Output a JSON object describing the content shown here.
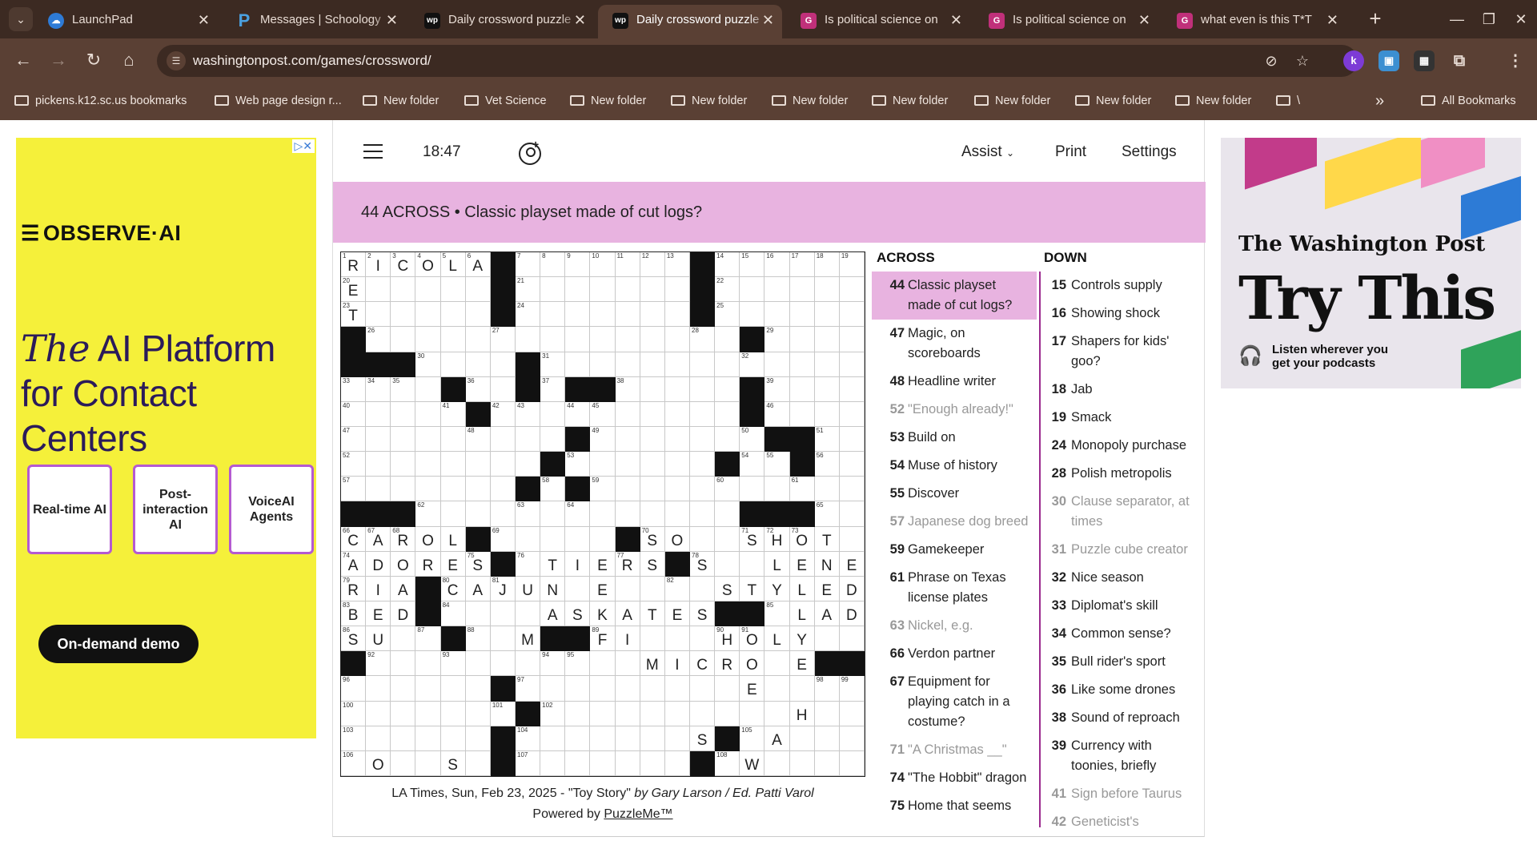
{
  "browser": {
    "tabs": [
      {
        "label": "LaunchPad",
        "icon": "cloud-icon",
        "active": false
      },
      {
        "label": "Messages | Schoology",
        "icon": "schoology-icon",
        "active": false
      },
      {
        "label": "Daily crossword puzzle",
        "icon": "wp-icon",
        "active": false
      },
      {
        "label": "Daily crossword puzzle",
        "icon": "wp-icon",
        "active": true
      },
      {
        "label": "Is political science on",
        "icon": "gl-icon",
        "active": false
      },
      {
        "label": "Is political science on",
        "icon": "gl-icon",
        "active": false
      },
      {
        "label": "what even is this T*T",
        "icon": "gl-icon",
        "active": false
      }
    ],
    "url": "washingtonpost.com/games/crossword/",
    "bookmarks": [
      "pickens.k12.sc.us bookmarks",
      "Web page design r...",
      "New folder",
      "Vet Science",
      "New folder",
      "New folder",
      "New folder",
      "New folder",
      "New folder",
      "New folder",
      "New folder",
      "\\"
    ],
    "all_bookmarks": "All Bookmarks"
  },
  "ad_left": {
    "brand": "OBSERVE·AI",
    "headline_the": "The",
    "headline_rest1": " AI Platform",
    "headline_rest2": "for Contact Centers",
    "cards": [
      "Real-time AI",
      "Post-interaction AI",
      "VoiceAI Agents"
    ],
    "cta": "On-demand demo"
  },
  "ad_right": {
    "brand": "The Washington Post",
    "headline": "Try This",
    "tagline_1": "Listen wherever you",
    "tagline_2": "get your podcasts"
  },
  "game": {
    "timer": "18:47",
    "menu": {
      "assist": "Assist",
      "print": "Print",
      "settings": "Settings"
    },
    "current_clue": "44 ACROSS • Classic playset made of cut logs?",
    "credit_line": "LA Times, Sun, Feb 23, 2025 - \"Toy Story\"",
    "credit_by": "by Gary Larson / Ed. Patti Varol",
    "powered_prefix": "Powered by ",
    "powered_link": "PuzzleMe™",
    "grid_size": 21,
    "grid_rows": [
      "RICOLA#.......#....",
      "E.....#.......#....",
      "T.....#.......#....",
      "#...............#..",
      "###....#...........",
      "....#..#.##.....#..",
      ".....#..........#..",
      ".........#.......##",
      "........#......#..#",
      ".......#.#.........",
      "###.............###",
      "CAROL#.....#SO..SHOT",
      "ADORES#.TIERS#S..LENE",
      "RIA#CAJUN.E....STYLED",
      "BED#....ASKATES##.LAD",
      "SU..#..M##FI...HOLY",
      "#...........MICRO.E###",
      "......#.........E....",
      ".......#..........H..",
      "......#.......S#.A...",
      ".O..S.#.......#.W...."
    ],
    "across_clues": [
      {
        "n": "44",
        "t": "Classic playset made of cut logs?",
        "state": "active"
      },
      {
        "n": "47",
        "t": "Magic, on scoreboards",
        "state": ""
      },
      {
        "n": "48",
        "t": "Headline writer",
        "state": ""
      },
      {
        "n": "52",
        "t": "\"Enough already!\"",
        "state": "done"
      },
      {
        "n": "53",
        "t": "Build on",
        "state": ""
      },
      {
        "n": "54",
        "t": "Muse of history",
        "state": ""
      },
      {
        "n": "55",
        "t": "Discover",
        "state": ""
      },
      {
        "n": "57",
        "t": "Japanese dog breed",
        "state": "done"
      },
      {
        "n": "59",
        "t": "Gamekeeper",
        "state": ""
      },
      {
        "n": "61",
        "t": "Phrase on Texas license plates",
        "state": ""
      },
      {
        "n": "63",
        "t": "Nickel, e.g.",
        "state": "done"
      },
      {
        "n": "66",
        "t": "Verdon partner",
        "state": ""
      },
      {
        "n": "67",
        "t": "Equipment for playing catch in a costume?",
        "state": ""
      },
      {
        "n": "71",
        "t": "\"A Christmas __\"",
        "state": "done"
      },
      {
        "n": "74",
        "t": "\"The Hobbit\" dragon",
        "state": ""
      },
      {
        "n": "75",
        "t": "Home that seems",
        "state": ""
      }
    ],
    "down_clues": [
      {
        "n": "15",
        "t": "Controls supply",
        "state": ""
      },
      {
        "n": "16",
        "t": "Showing shock",
        "state": ""
      },
      {
        "n": "17",
        "t": "Shapers for kids' goo?",
        "state": ""
      },
      {
        "n": "18",
        "t": "Jab",
        "state": ""
      },
      {
        "n": "19",
        "t": "Smack",
        "state": ""
      },
      {
        "n": "24",
        "t": "Monopoly purchase",
        "state": ""
      },
      {
        "n": "28",
        "t": "Polish metropolis",
        "state": ""
      },
      {
        "n": "30",
        "t": "Clause separator, at times",
        "state": "done"
      },
      {
        "n": "31",
        "t": "Puzzle cube creator",
        "state": "done"
      },
      {
        "n": "32",
        "t": "Nice season",
        "state": ""
      },
      {
        "n": "33",
        "t": "Diplomat's skill",
        "state": ""
      },
      {
        "n": "34",
        "t": "Common sense?",
        "state": ""
      },
      {
        "n": "35",
        "t": "Bull rider's sport",
        "state": ""
      },
      {
        "n": "36",
        "t": "Like some drones",
        "state": ""
      },
      {
        "n": "38",
        "t": "Sound of reproach",
        "state": ""
      },
      {
        "n": "39",
        "t": "Currency with toonies, briefly",
        "state": ""
      },
      {
        "n": "41",
        "t": "Sign before Taurus",
        "state": "done"
      },
      {
        "n": "42",
        "t": "Geneticist's research subject,",
        "state": "done"
      }
    ],
    "accent_color": "#9b2b8f",
    "highlight_color": "#e8b3e0"
  }
}
